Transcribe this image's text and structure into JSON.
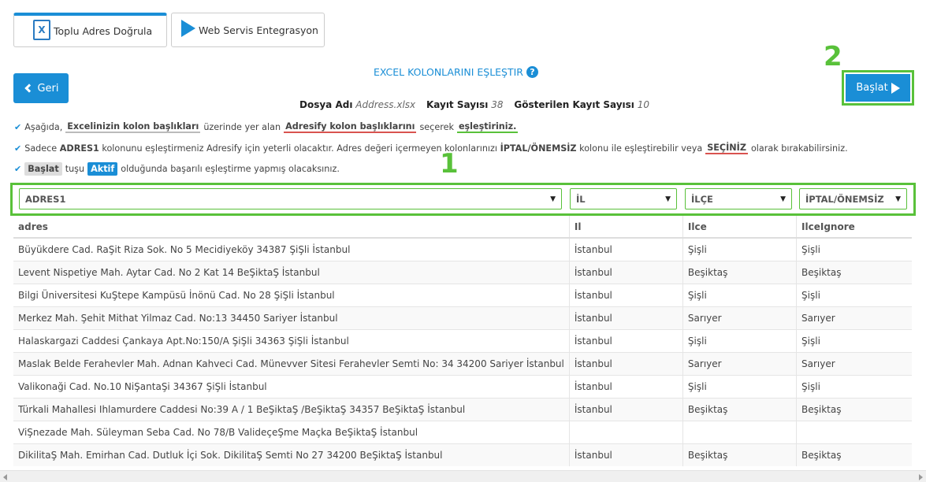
{
  "tabs": [
    {
      "label": "Toplu Adres Doğrula",
      "icon": "excel-icon",
      "active": true
    },
    {
      "label": "Web Servis Entegrasyon",
      "icon": "play-icon",
      "active": false
    }
  ],
  "excel_icon_glyph": "X",
  "page_title": "EXCEL KOLONLARINI EŞLEŞTIR",
  "help_glyph": "?",
  "back_label": "Geri",
  "start_label": "Başlat",
  "markers": {
    "one": "1",
    "two": "2"
  },
  "colors": {
    "accent": "#1a8ed6",
    "highlight": "#59c13a",
    "red": "#d9534f"
  },
  "file_info": {
    "file_label": "Dosya Adı",
    "file_value": "Address.xlsx",
    "count_label": "Kayıt Sayısı",
    "count_value": "38",
    "shown_label": "Gösterilen Kayıt Sayısı",
    "shown_value": "10"
  },
  "info1": {
    "a": "Aşağıda,",
    "b": "Excelinizin kolon başlıkları",
    "c": "üzerinde yer alan",
    "d": "Adresify kolon başlıklarını",
    "e": "seçerek",
    "f": "eşleştiriniz."
  },
  "info2": {
    "a": "Sadece",
    "b": "ADRES1",
    "c": "kolonunu eşleştirmeniz Adresify için yeterli olacaktır. Adres değeri içermeyen kolonlarınızı",
    "d": "İPTAL/ÖNEMSİZ",
    "e": "kolonu ile eşleştirebilir veya",
    "f": "SEÇİNİZ",
    "g": "olarak bırakabilirsiniz."
  },
  "info3": {
    "a": "Başlat",
    "b": "tuşu",
    "c": "Aktif",
    "d": "olduğunda başarılı eşleştirme yapmış olacaksınız."
  },
  "selects": [
    "ADRES1",
    "İL",
    "İLÇE",
    "İPTAL/ÖNEMSİZ"
  ],
  "table": {
    "headers": [
      "adres",
      "Il",
      "Ilce",
      "IlceIgnore"
    ],
    "rows": [
      [
        "Büyükdere Cad. RaŞit Riza Sok. No 5 Mecidiyeköy 34387 ŞiŞli İstanbul",
        "İstanbul",
        "Şişli",
        "Şişli"
      ],
      [
        "Levent Nispetiye Mah. Aytar Cad. No 2 Kat 14 BeŞiktaŞ İstanbul",
        "İstanbul",
        "Beşiktaş",
        "Beşiktaş"
      ],
      [
        "Bilgi Üniversitesi KuŞtepe Kampüsü İnönü Cad. No 28 ŞiŞli İstanbul",
        "İstanbul",
        "Şişli",
        "Şişli"
      ],
      [
        "Merkez Mah. Şehit Mithat Yilmaz Cad. No:13 34450 Sariyer İstanbul",
        "İstanbul",
        "Sarıyer",
        "Sarıyer"
      ],
      [
        "Halaskargazi Caddesi Çankaya Apt.No:150/A ŞiŞli 34363 ŞiŞli İstanbul",
        "İstanbul",
        "Şişli",
        "Şişli"
      ],
      [
        "Maslak Belde Ferahevler Mah. Adnan Kahveci Cad. Münevver Sitesi Ferahevler Semti No: 34 34200 Sariyer İstanbul",
        "İstanbul",
        "Sarıyer",
        "Sarıyer"
      ],
      [
        "Valikonaği Cad. No.10 NiŞantaŞi 34367 ŞiŞli İstanbul",
        "İstanbul",
        "Şişli",
        "Şişli"
      ],
      [
        "Türkali Mahallesi Ihlamurdere Caddesi No:39 A / 1 BeŞiktaŞ /BeŞiktaŞ 34357 BeŞiktaŞ İstanbul",
        "İstanbul",
        "Beşiktaş",
        "Beşiktaş"
      ],
      [
        "ViŞnezade Mah. Süleyman Seba Cad. No 78/B ValideçeŞme Maçka BeŞiktaŞ İstanbul",
        "",
        "",
        ""
      ],
      [
        "DikilitaŞ Mah. Emirhan Cad. Dutluk İçi Sok. DikilitaŞ Semti No 27 34200 BeŞiktaŞ İstanbul",
        "İstanbul",
        "Beşiktaş",
        "Beşiktaş"
      ]
    ]
  }
}
